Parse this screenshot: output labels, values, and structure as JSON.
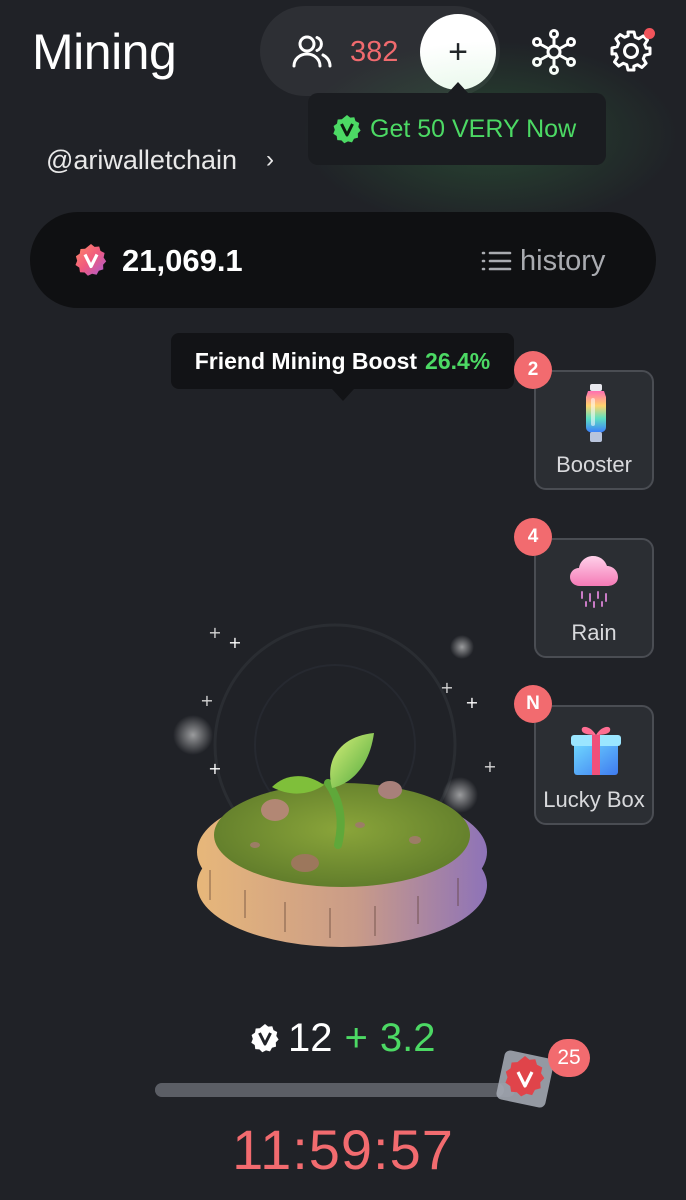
{
  "header": {
    "title": "Mining",
    "friends_count": "382",
    "add_label": "+",
    "settings_has_notification": true
  },
  "promo": {
    "text": "Get 50 VERY Now"
  },
  "user": {
    "handle": "@ariwalletchain",
    "chevron": "›"
  },
  "balance": {
    "value": "21,069.1",
    "history_label": "history"
  },
  "boost": {
    "label": "Friend Mining Boost",
    "value": "26.4%"
  },
  "side_items": [
    {
      "label": "Booster",
      "badge": "2",
      "icon": "booster-bottle-icon"
    },
    {
      "label": "Rain",
      "badge": "4",
      "icon": "rain-cloud-icon"
    },
    {
      "label": "Lucky Box",
      "badge": "N",
      "icon": "gift-box-icon"
    }
  ],
  "mining": {
    "base": "12",
    "plus": "+",
    "bonus": "3.2",
    "progress": 0.97,
    "stamp_count": "25",
    "timer": "11:59:57"
  },
  "colors": {
    "background": "#202227",
    "accent_red": "#f26b6f",
    "accent_green": "#4cd964"
  }
}
